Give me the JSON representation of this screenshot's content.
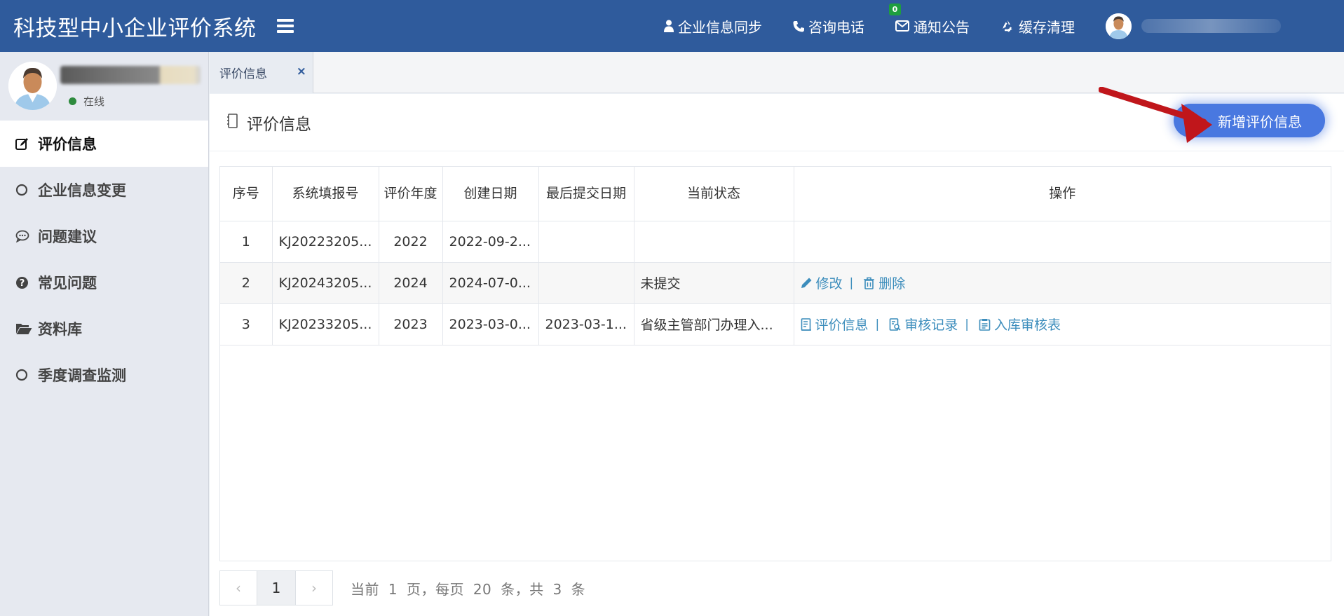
{
  "app": {
    "title": "科技型中小企业评价系统"
  },
  "header": {
    "nav": [
      {
        "icon": "user-icon",
        "label": "企业信息同步"
      },
      {
        "icon": "phone-icon",
        "label": "咨询电话"
      },
      {
        "icon": "envelope-icon",
        "label": "通知公告",
        "badge": "0"
      },
      {
        "icon": "recycle-icon",
        "label": "缓存清理"
      }
    ]
  },
  "sidebar": {
    "status": "在线",
    "menu": [
      {
        "icon": "edit-icon",
        "label": "评价信息",
        "active": true
      },
      {
        "icon": "circle-icon",
        "label": "企业信息变更"
      },
      {
        "icon": "comment-icon",
        "label": "问题建议"
      },
      {
        "icon": "question-circle-icon",
        "label": "常见问题"
      },
      {
        "icon": "folder-open-icon",
        "label": "资料库"
      },
      {
        "icon": "circle-icon",
        "label": "季度调查监测"
      }
    ]
  },
  "tabs": [
    {
      "label": "评价信息",
      "close": "×"
    }
  ],
  "panel": {
    "title": "评价信息",
    "add_button": "新增评价信息"
  },
  "table": {
    "headers": [
      "序号",
      "系统填报号",
      "评价年度",
      "创建日期",
      "最后提交日期",
      "当前状态",
      "操作"
    ],
    "rows": [
      {
        "no": "1",
        "code": "KJ20223205...",
        "year": "2022",
        "created": "2022-09-2...",
        "submitted": "",
        "status": "",
        "actions": []
      },
      {
        "no": "2",
        "code": "KJ20243205...",
        "year": "2024",
        "created": "2024-07-0...",
        "submitted": "",
        "status": "未提交",
        "actions": [
          "修改",
          "删除"
        ]
      },
      {
        "no": "3",
        "code": "KJ20233205...",
        "year": "2023",
        "created": "2023-03-0...",
        "submitted": "2023-03-1...",
        "status": "省级主管部门办理入...",
        "actions": [
          "评价信息",
          "审核记录",
          "入库审核表"
        ]
      }
    ],
    "separator": "|"
  },
  "pagination": {
    "prev": "‹",
    "next": "›",
    "current": "1",
    "info_prefix": "当前",
    "info_page": "1",
    "info_page_unit": "页，每页",
    "info_size": "20",
    "info_size_unit": "条，共",
    "info_total": "3",
    "info_total_unit": "条"
  },
  "colors": {
    "header_bg": "#2f5b9c",
    "accent": "#4978e0",
    "link": "#3c8dbc",
    "online": "#2e8b3e",
    "badge": "#1e9e3e",
    "arrow": "#c0161b"
  }
}
